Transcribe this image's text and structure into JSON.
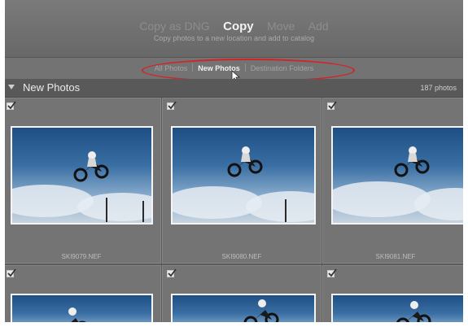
{
  "modes": [
    {
      "label": "Copy as DNG",
      "state": "dim"
    },
    {
      "label": "Copy",
      "state": "active"
    },
    {
      "label": "Move",
      "state": "dim"
    },
    {
      "label": "Add",
      "state": "dim"
    }
  ],
  "mode_description": "Copy photos to a new location and add to catalog",
  "filters": [
    {
      "label": "All Photos",
      "active": false
    },
    {
      "label": "New Photos",
      "active": true
    },
    {
      "label": "Destination Folders",
      "active": false
    }
  ],
  "section": {
    "title": "New Photos",
    "count": "187 photos"
  },
  "photos": [
    {
      "filename": "SKI9079.NEF",
      "checked": true
    },
    {
      "filename": "SKI9080.NEF",
      "checked": true
    },
    {
      "filename": "SKI9081.NEF",
      "checked": true
    },
    {
      "filename": "",
      "checked": true
    },
    {
      "filename": "",
      "checked": true
    },
    {
      "filename": "",
      "checked": true
    }
  ],
  "colors": {
    "highlight_ring": "#d42226",
    "panel": "#6c6c6c"
  }
}
